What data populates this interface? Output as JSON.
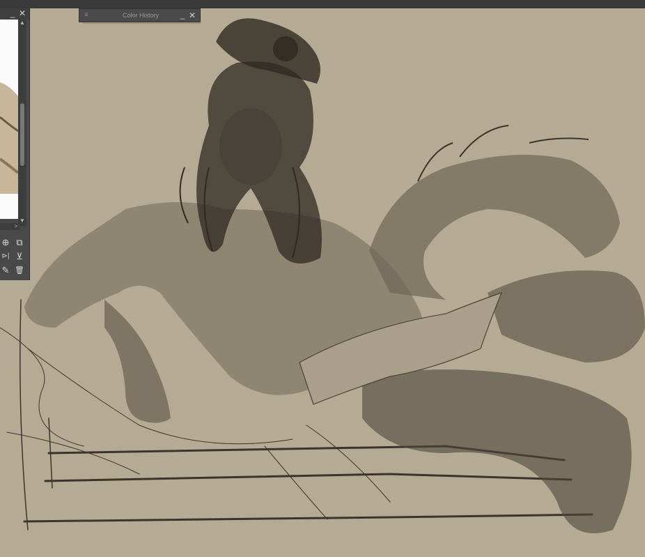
{
  "color_history": {
    "title": "Color History",
    "grip_icon": "≡",
    "minimize_icon": "_",
    "close_icon": "✕"
  },
  "navigator": {
    "minimize_icon": "_",
    "close_icon": "✕",
    "scroll_up": "▲",
    "scroll_down": "▼",
    "scroll_right": ">",
    "tools": {
      "zoom_fit": "⊕",
      "zoom_rect": "⧉",
      "flip_horizontal": "⊳|",
      "flip_vertical": "⊻",
      "edit": "✎",
      "delete": "🗑"
    }
  },
  "colors": {
    "canvas": "#b5aa93",
    "panel": "#494949",
    "topbar": "#3a3a3a",
    "ink": "#2a2620"
  }
}
